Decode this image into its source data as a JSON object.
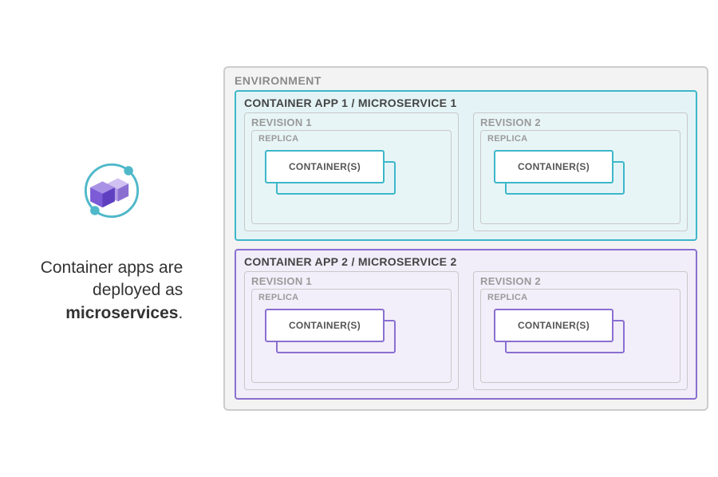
{
  "caption": {
    "line1": "Container apps are",
    "line2": "deployed as",
    "bold": "microservices",
    "period": "."
  },
  "env_label": "ENVIRONMENT",
  "apps": [
    {
      "title": "CONTAINER APP 1 / MICROSERVICE 1",
      "revisions": [
        {
          "label": "REVISION 1",
          "replica_label": "REPLICA",
          "container_label": "CONTAINER(S)"
        },
        {
          "label": "REVISION 2",
          "replica_label": "REPLICA",
          "container_label": "CONTAINER(S)"
        }
      ]
    },
    {
      "title": "CONTAINER APP 2 / MICROSERVICE 2",
      "revisions": [
        {
          "label": "REVISION 1",
          "replica_label": "REPLICA",
          "container_label": "CONTAINER(S)"
        },
        {
          "label": "REVISION 2",
          "replica_label": "REPLICA",
          "container_label": "CONTAINER(S)"
        }
      ]
    }
  ],
  "colors": {
    "app1_border": "#3db7c9",
    "app1_bg": "#e4f4f6",
    "app2_border": "#8a6fd1",
    "app2_bg": "#f1edf9",
    "neutral_border": "#c8c8c8",
    "env_bg": "#f3f3f3"
  }
}
